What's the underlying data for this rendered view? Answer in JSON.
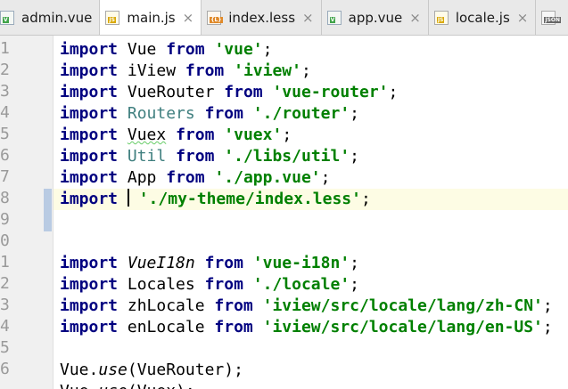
{
  "tabs": [
    {
      "label": "admin.vue",
      "icon": "vue-file-icon",
      "badge": "V"
    },
    {
      "label": "main.js",
      "icon": "js-file-icon",
      "badge": "JS",
      "active": true
    },
    {
      "label": "index.less",
      "icon": "less-file-icon",
      "badge": "{L}"
    },
    {
      "label": "app.vue",
      "icon": "vue-file-icon",
      "badge": "V"
    },
    {
      "label": "locale.js",
      "icon": "js-file-icon",
      "badge": "JS"
    },
    {
      "label": "",
      "icon": "json-file-icon",
      "badge": "JSON"
    }
  ],
  "close_glyph": "×",
  "gutter": {
    "line_numbers": [
      "1",
      "2",
      "3",
      "4",
      "5",
      "6",
      "7",
      "8",
      "9",
      "0",
      "1",
      "2",
      "3",
      "4",
      "5",
      "6"
    ]
  },
  "code": {
    "l1": {
      "kw": "import",
      "name": "Vue",
      "from": "from",
      "str": "'vue'",
      "end": ";"
    },
    "l2": {
      "kw": "import",
      "name": "iView",
      "from": "from",
      "str": "'iview'",
      "end": ";"
    },
    "l3": {
      "kw": "import",
      "name": "VueRouter",
      "from": "from",
      "str": "'vue-router'",
      "end": ";"
    },
    "l4": {
      "kw": "import",
      "name": "Routers",
      "from": "from",
      "str": "'./router'",
      "end": ";"
    },
    "l5": {
      "kw": "import",
      "name": "Vuex",
      "from": "from",
      "str": "'vuex'",
      "end": ";"
    },
    "l6": {
      "kw": "import",
      "name": "Util",
      "from": "from",
      "str": "'./libs/util'",
      "end": ";"
    },
    "l7": {
      "kw": "import",
      "name": "App",
      "from": "from",
      "str": "'./app.vue'",
      "end": ";"
    },
    "l8": {
      "kw": "import",
      "str": "'./my-theme/index.less'",
      "end": ";"
    },
    "l11": {
      "kw": "import",
      "name": "VueI18n",
      "from": "from",
      "str": "'vue-i18n'",
      "end": ";"
    },
    "l12": {
      "kw": "import",
      "name": "Locales",
      "from": "from",
      "str": "'./locale'",
      "end": ";"
    },
    "l13": {
      "kw": "import",
      "name": "zhLocale",
      "from": "from",
      "str": "'iview/src/locale/lang/zh-CN'",
      "end": ";"
    },
    "l14": {
      "kw": "import",
      "name": "enLocale",
      "from": "from",
      "str": "'iview/src/locale/lang/en-US'",
      "end": ";"
    },
    "l16": {
      "obj": "Vue",
      "dot": ".",
      "method": "use",
      "open": "(",
      "arg": "VueRouter",
      "close": ");"
    },
    "l17": {
      "obj": "Vue",
      "dot": ".",
      "method": "use",
      "open": "(",
      "arg": "Vuex",
      "close": ");"
    }
  }
}
